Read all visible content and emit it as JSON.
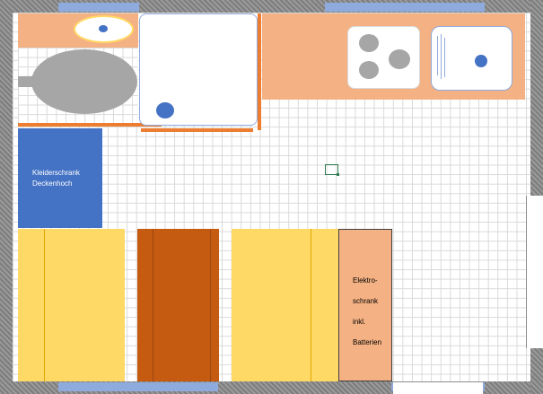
{
  "colors": {
    "wall": "#8c8c8c",
    "window": "#8faadc",
    "counter": "#f4b183",
    "wardrobe": "#4472c4",
    "bed": "#ffd966",
    "table": "#c55a11",
    "fixture": "#a6a6a6",
    "drain": "#4472c4"
  },
  "wardrobe": {
    "line1": "Kleiderschrank",
    "line2": "Deckenhoch"
  },
  "electric_cabinet": {
    "line1": "Elektro-",
    "line2": "schrank",
    "line3": "inkl.",
    "line4": "Batterien"
  }
}
